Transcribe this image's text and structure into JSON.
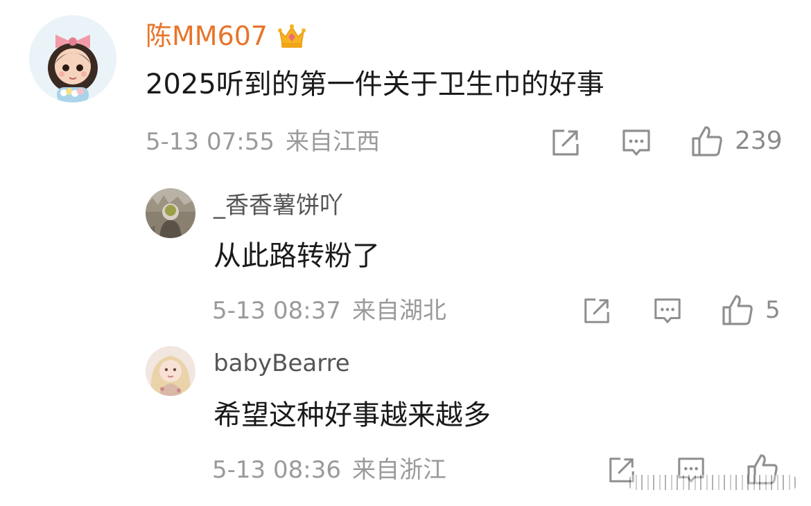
{
  "comments": [
    {
      "username": "陈MM607",
      "username_color": "#e8742a",
      "badge_icon": "crown-badge-icon",
      "text": "2025听到的第一件关于卫生巾的好事",
      "date": "5-13 07:55",
      "location": "来自江西",
      "likes": "239"
    },
    {
      "username": "_香香薯饼吖",
      "username_color": "#555555",
      "text": "从此路转粉了",
      "date": "5-13 08:37",
      "location": "来自湖北",
      "likes": "5"
    },
    {
      "username": "babyBearre",
      "username_color": "#555555",
      "text": "希望这种好事越来越多",
      "date": "5-13 08:36",
      "location": "来自浙江",
      "likes": ""
    }
  ],
  "colors": {
    "meta_text": "#9a9a9a",
    "icon_stroke": "#8f8f8f",
    "body_text": "#1a1a1a"
  }
}
